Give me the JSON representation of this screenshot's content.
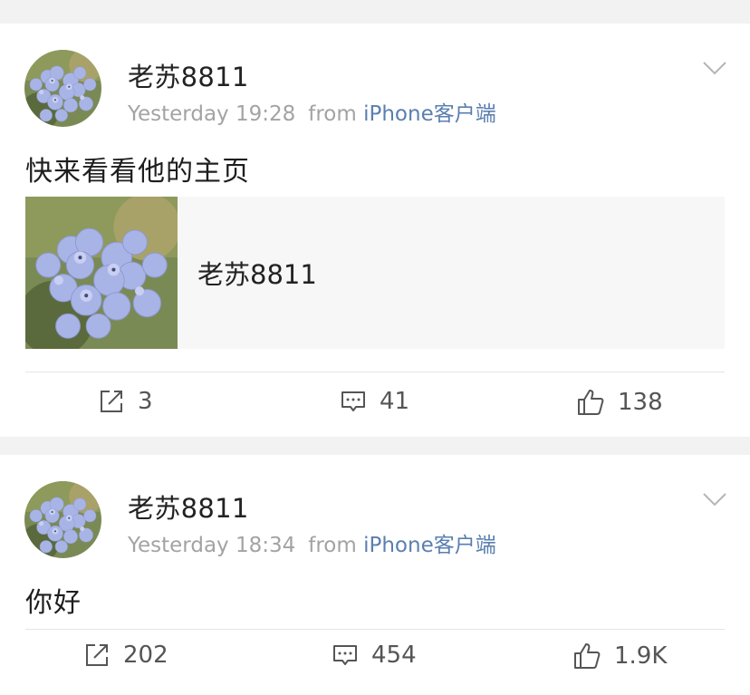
{
  "posts": [
    {
      "username": "老苏8811",
      "time": "Yesterday 19:28",
      "from_label": "from",
      "source": "iPhone客户端",
      "content": "快来看看他的主页",
      "card": {
        "title": "老苏8811"
      },
      "actions": {
        "repost": "3",
        "comment": "41",
        "like": "138"
      }
    },
    {
      "username": "老苏8811",
      "time": "Yesterday 18:34",
      "from_label": "from",
      "source": "iPhone客户端",
      "content": "你好",
      "actions": {
        "repost": "202",
        "comment": "454",
        "like": "1.9K"
      }
    }
  ],
  "colors": {
    "background": "#f2f2f2",
    "card": "#ffffff",
    "link": "#5a7faf",
    "meta": "#a3a3a3"
  },
  "icons": [
    "avatar-flower-image",
    "chevron-down-icon",
    "repost-icon",
    "comment-icon",
    "thumbs-up-icon"
  ]
}
